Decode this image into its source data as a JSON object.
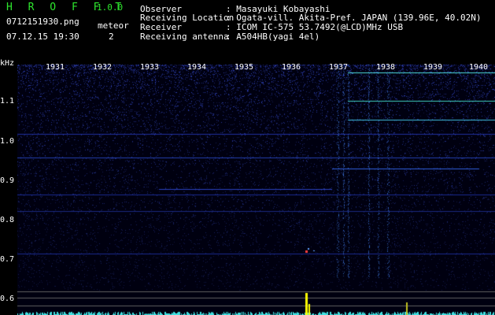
{
  "header": {
    "app_name": "H R O F F T",
    "version": "1.0.0",
    "filename": "0712151930.png",
    "datetime": "07.12.15 19:30",
    "meteor_label": "meteor",
    "meteor_count": "2"
  },
  "info": [
    {
      "key": "Observer",
      "value": ": Masayuki Kobayashi"
    },
    {
      "key": "Receiving Location",
      "value": ": Ogata-vill. Akita-Pref. JAPAN (139.96E, 40.02N)"
    },
    {
      "key": "Receiver",
      "value": ": ICOM IC-575 53.7492(@LCD)MHz USB"
    },
    {
      "key": "Receiving antenna",
      "value": ": A504HB(yagi 4el)"
    }
  ],
  "spectrum": {
    "unit_label": "kHz",
    "y_ticks": [
      "1.1",
      "1.0",
      "0.9",
      "0.8",
      "0.7",
      "0.6"
    ],
    "time_ticks": [
      "1931",
      "1932",
      "1933",
      "1934",
      "1935",
      "1936",
      "1937",
      "1938",
      "1939",
      "1940"
    ],
    "colors": {
      "background": "#000010",
      "noise": "#2030a0",
      "signal": "#40c0ff",
      "peak": "#ffff00",
      "trace": "#40e0e0"
    }
  }
}
